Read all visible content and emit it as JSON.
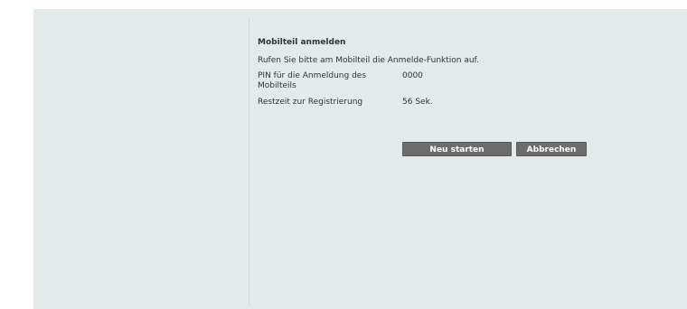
{
  "dialog": {
    "title": "Mobilteil anmelden",
    "instruction": "Rufen Sie bitte am Mobilteil die Anmelde-Funktion auf.",
    "pin_label": "PIN für die Anmeldung des Mobilteils",
    "pin_value": "0000",
    "remaining_label": "Restzeit zur Registrierung",
    "remaining_value": "56 Sek."
  },
  "buttons": {
    "restart": "Neu starten",
    "cancel": "Abbrechen"
  },
  "colors": {
    "panel_background": "#e4e9e9",
    "button_background": "#6d6d6d"
  }
}
